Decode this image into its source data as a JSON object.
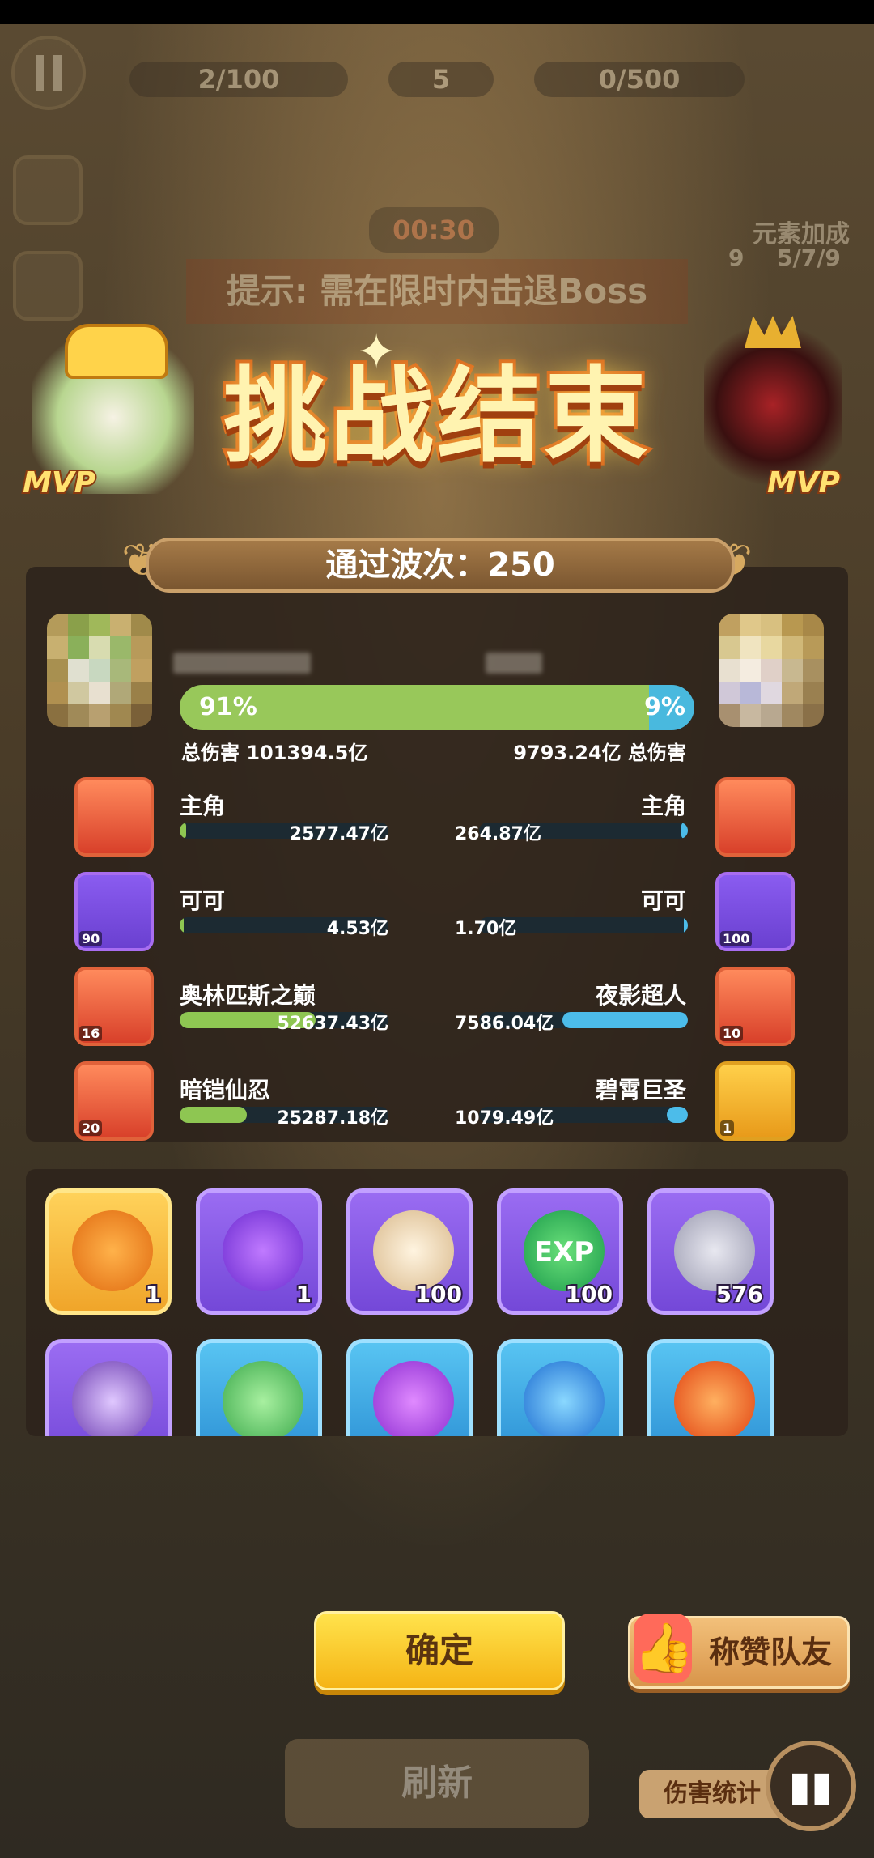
{
  "hud": {
    "wave_counter": "2/100",
    "sun_counter": "5",
    "coin_counter": "0/500",
    "timer": "00:30",
    "element_bonus_label": "元素加成",
    "element_bonus_value": "5/7/9",
    "element_bonus_level": "9",
    "hint": "提示: 需在限时内击退Boss"
  },
  "title": "挑战结束",
  "mvp_left": "MVP",
  "mvp_right": "MVP",
  "wave": {
    "label": "通过波次：",
    "value": "250"
  },
  "totals": {
    "left_pct": "91%",
    "right_pct": "9%",
    "left_fraction": 0.912,
    "left_label": "总伤害 101394.5亿",
    "right_label": "9793.24亿 总伤害"
  },
  "rows": [
    {
      "left_name": "主角",
      "left_val": "2577.47亿",
      "left_frac": 0.03,
      "left_level": "",
      "right_name": "主角",
      "right_val": "264.87亿",
      "right_frac": 0.03,
      "right_level": ""
    },
    {
      "left_name": "可可",
      "left_val": "4.53亿",
      "left_frac": 0.0,
      "left_level": "90",
      "right_name": "可可",
      "right_val": "1.70亿",
      "right_frac": 0.0,
      "right_level": "100"
    },
    {
      "left_name": "奥林匹斯之巅",
      "left_val": "52637.43亿",
      "left_frac": 0.65,
      "left_level": "16",
      "right_name": "夜影超人",
      "right_val": "7586.04亿",
      "right_frac": 0.6,
      "right_level": "10"
    },
    {
      "left_name": "暗铠仙忍",
      "left_val": "25287.18亿",
      "left_frac": 0.32,
      "left_level": "20",
      "right_name": "碧霄巨圣",
      "right_val": "1079.49亿",
      "right_frac": 0.1,
      "right_level": "1"
    }
  ],
  "rewards": [
    {
      "name": "golden-potion-icon",
      "count": "1",
      "style": "gold"
    },
    {
      "name": "purple-potion-icon",
      "count": "1",
      "style": "purple"
    },
    {
      "name": "food-bowl-icon",
      "count": "100",
      "style": "purple"
    },
    {
      "name": "exp-badge-icon",
      "count": "100",
      "style": "purple"
    },
    {
      "name": "silver-coin-icon",
      "count": "576",
      "style": "purple"
    },
    {
      "name": "purple-emblem-icon",
      "count": "",
      "style": "purple"
    },
    {
      "name": "green-sprout-orb-icon",
      "count": "",
      "style": "blue"
    },
    {
      "name": "purple-sprout-orb-icon",
      "count": "",
      "style": "blue"
    },
    {
      "name": "blue-sprout-orb-icon",
      "count": "",
      "style": "blue"
    },
    {
      "name": "fire-sprout-orb-icon",
      "count": "",
      "style": "blue"
    }
  ],
  "exp_text": "EXP",
  "buttons": {
    "confirm": "确定",
    "praise": "称赞队友",
    "refresh": "刷新",
    "damage_stats": "伤害统计"
  },
  "colors": {
    "left_bar": "#8ec652",
    "right_bar": "#49b9de",
    "title_fill": "#fff3b0",
    "confirm_bg": "#f5b415"
  }
}
